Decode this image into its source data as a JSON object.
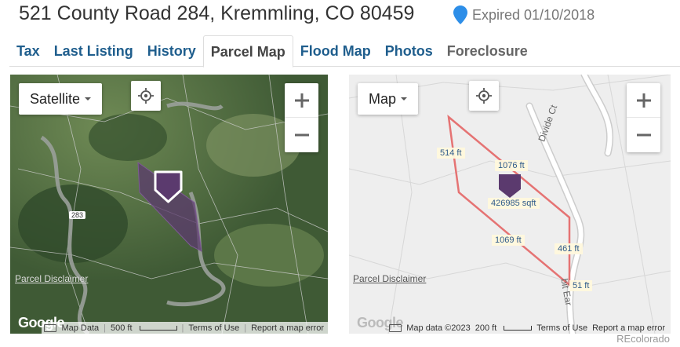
{
  "header": {
    "address": "521 County Road 284, Kremmling, CO 80459",
    "status": "Expired 01/10/2018",
    "pin_color": "#2d8ee8"
  },
  "tabs": [
    {
      "label": "Tax"
    },
    {
      "label": "Last Listing"
    },
    {
      "label": "History"
    },
    {
      "label": "Parcel Map"
    },
    {
      "label": "Flood Map"
    },
    {
      "label": "Photos"
    },
    {
      "label": "Foreclosure"
    }
  ],
  "active_tab": "Parcel Map",
  "satellite_map": {
    "type_label": "Satellite",
    "road_label": "283",
    "disclaimer": "Parcel Disclaimer",
    "logo": "Google",
    "footer": {
      "map_data": "Map Data",
      "scale": "500 ft",
      "terms": "Terms of Use",
      "report": "Report a map error"
    }
  },
  "road_map": {
    "type_label": "Map",
    "street_label": "Divide Ct",
    "street_label_2": "bit Ear",
    "disclaimer": "Parcel Disclaimer",
    "logo": "Google",
    "dimensions": {
      "left": "514 ft",
      "top": "1076 ft",
      "area": "426985 sqft",
      "bottom": "1069 ft",
      "right": "461 ft",
      "short": "51 ft"
    },
    "footer": {
      "map_data": "Map data ©2023",
      "scale": "200 ft",
      "terms": "Terms of Use",
      "report": "Report a map error"
    }
  },
  "parcel_color": "#5b3a6e",
  "parcel_outline": "#e57373",
  "watermark": "REcolorado"
}
